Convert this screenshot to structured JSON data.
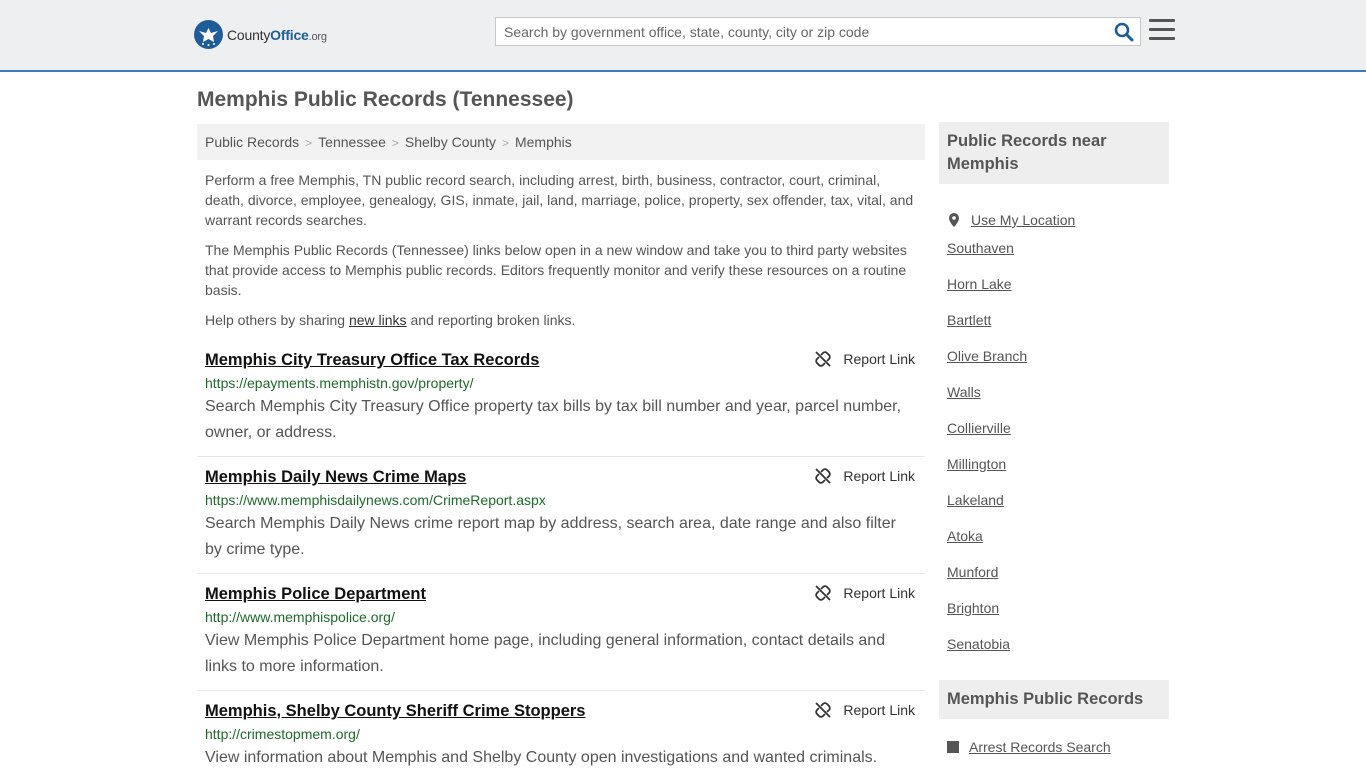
{
  "header": {
    "logo": {
      "county": "County",
      "office": "Office",
      "org": ".org"
    },
    "search_placeholder": "Search by government office, state, county, city or zip code",
    "icons": {
      "search": "search-icon",
      "menu": "hamburger-menu-icon"
    }
  },
  "page_title": "Memphis Public Records (Tennessee)",
  "breadcrumb": [
    "Public Records",
    "Tennessee",
    "Shelby County",
    "Memphis"
  ],
  "intro": {
    "p1": "Perform a free Memphis, TN public record search, including arrest, birth, business, contractor, court, criminal, death, divorce, employee, genealogy, GIS, inmate, jail, land, marriage, police, property, sex offender, tax, vital, and warrant records searches.",
    "p2": "The Memphis Public Records (Tennessee) links below open in a new window and take you to third party websites that provide access to Memphis public records. Editors frequently monitor and verify these resources on a routine basis.",
    "p3_before": "Help others by sharing ",
    "p3_link": "new links",
    "p3_after": " and reporting broken links."
  },
  "report_label": "Report Link",
  "records": [
    {
      "title": "Memphis City Treasury Office Tax Records",
      "url": "https://epayments.memphistn.gov/property/",
      "desc": "Search Memphis City Treasury Office property tax bills by tax bill number and year, parcel number, owner, or address."
    },
    {
      "title": "Memphis Daily News Crime Maps",
      "url": "https://www.memphisdailynews.com/CrimeReport.aspx",
      "desc": "Search Memphis Daily News crime report map by address, search area, date range and also filter by crime type."
    },
    {
      "title": "Memphis Police Department",
      "url": "http://www.memphispolice.org/",
      "desc": "View Memphis Police Department home page, including general information, contact details and links to more information."
    },
    {
      "title": "Memphis, Shelby County Sheriff Crime Stoppers",
      "url": "http://crimestopmem.org/",
      "desc": "View information about Memphis and Shelby County open investigations and wanted criminals."
    }
  ],
  "sidebar": {
    "nearby_heading": "Public Records near Memphis",
    "use_location": "Use My Location",
    "nearby": [
      "Southaven",
      "Horn Lake",
      "Bartlett",
      "Olive Branch",
      "Walls",
      "Collierville",
      "Millington",
      "Lakeland",
      "Atoka",
      "Munford",
      "Brighton",
      "Senatobia"
    ],
    "records_heading": "Memphis Public Records",
    "records_links": [
      "Arrest Records Search"
    ]
  },
  "colors": {
    "brand_blue": "#1f5d99",
    "url_green": "#1c6b2a",
    "header_bg": "#eeeff0"
  }
}
